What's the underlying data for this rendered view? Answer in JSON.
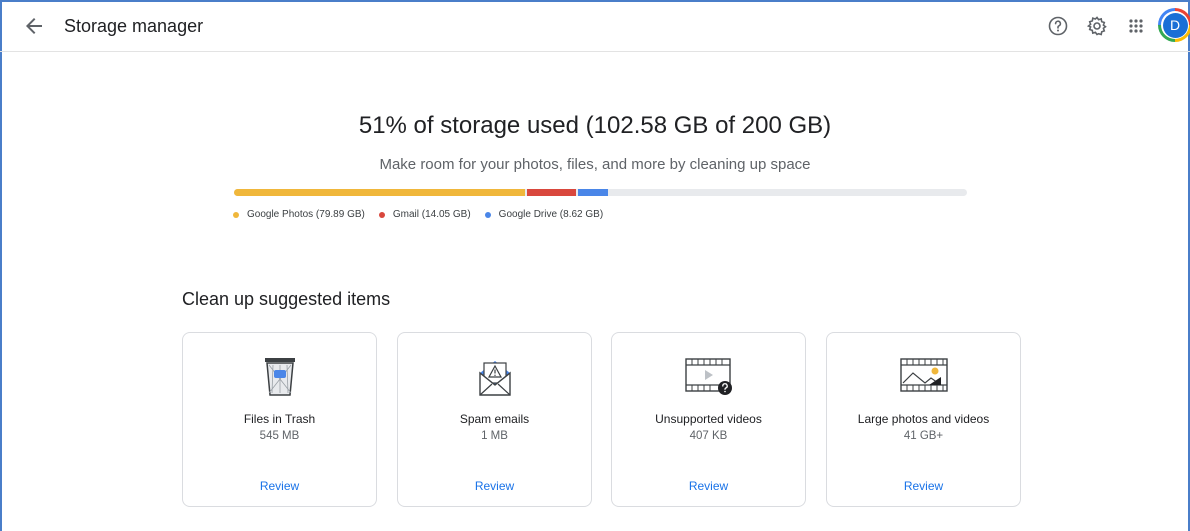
{
  "header": {
    "title": "Storage manager",
    "icons": [
      "back-arrow-icon",
      "help-icon",
      "settings-gear-icon",
      "apps-grid-icon"
    ],
    "avatar_initial": "D"
  },
  "summary": {
    "title": "51% of storage used (102.58 GB of 200 GB)",
    "subtitle": "Make room for your photos, files, and more by cleaning up space",
    "used_percent": 51,
    "total_gb": 200,
    "segments": [
      {
        "label": "Google Photos (79.89 GB)",
        "gb": 79.89,
        "color": "#f0b73b"
      },
      {
        "label": "Gmail (14.05 GB)",
        "gb": 14.05,
        "color": "#d9473d"
      },
      {
        "label": "Google Drive (8.62 GB)",
        "gb": 8.62,
        "color": "#4a86e8"
      }
    ]
  },
  "section": {
    "title": "Clean up suggested items",
    "cards": [
      {
        "icon": "trash-bin-icon",
        "title": "Files in Trash",
        "size": "545 MB",
        "action": "Review"
      },
      {
        "icon": "spam-envelope-icon",
        "title": "Spam emails",
        "size": "1 MB",
        "action": "Review"
      },
      {
        "icon": "unsupported-video-icon",
        "title": "Unsupported videos",
        "size": "407 KB",
        "action": "Review"
      },
      {
        "icon": "large-photo-icon",
        "title": "Large photos and videos",
        "size": "41 GB+",
        "action": "Review"
      }
    ]
  }
}
